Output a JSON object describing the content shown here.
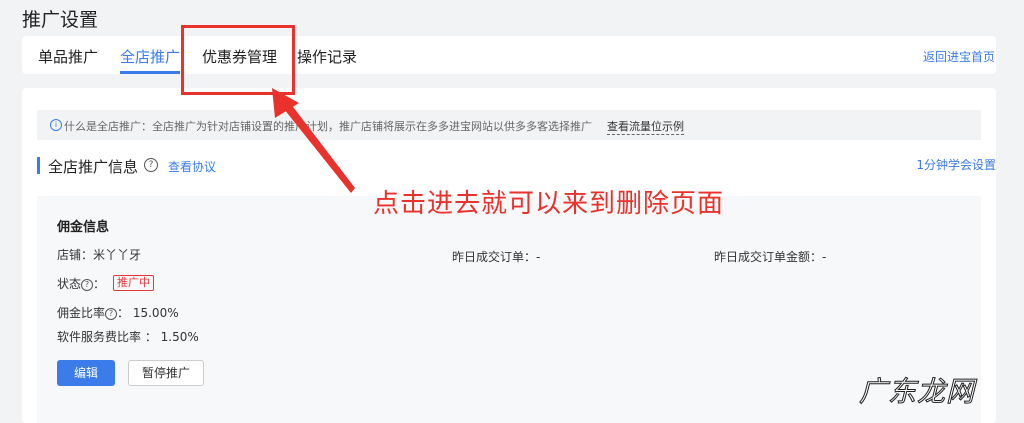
{
  "header": {
    "title": "推广设置"
  },
  "tabs": [
    {
      "label": "单品推广",
      "active": false
    },
    {
      "label": "全店推广",
      "active": true
    },
    {
      "label": "优惠券管理",
      "active": false
    },
    {
      "label": "操作记录",
      "active": false
    }
  ],
  "back_link": "返回进宝首页",
  "info": {
    "text": "什么是全店推广：全店推广为针对店铺设置的推广计划，推广店铺将展示在多多进宝网站以供多多客选择推广",
    "link": "查看流量位示例"
  },
  "section": {
    "title": "全店推广信息",
    "protocol_link": "查看协议",
    "learn_link": "1分钟学会设置"
  },
  "commission": {
    "title": "佣金信息",
    "shop_label": "店铺：",
    "shop_value": "米丫丫牙",
    "yesterday_orders_label": "昨日成交订单：",
    "yesterday_orders_value": "-",
    "yesterday_amount_label": "昨日成交订单金额：",
    "yesterday_amount_value": "-",
    "status_label": "状态",
    "status_value": "推广中",
    "rate_label": "佣金比率",
    "rate_value": "15.00%",
    "service_label": "软件服务费比率 ：",
    "service_value": "1.50%",
    "edit_button": "编辑",
    "pause_button": "暂停推广"
  },
  "annotation": {
    "text": "点击进去就可以来到删除页面",
    "color": "#e8322b"
  },
  "watermark": "广东龙网",
  "colors": {
    "accent": "#3b7bea",
    "danger": "#e4393c"
  }
}
